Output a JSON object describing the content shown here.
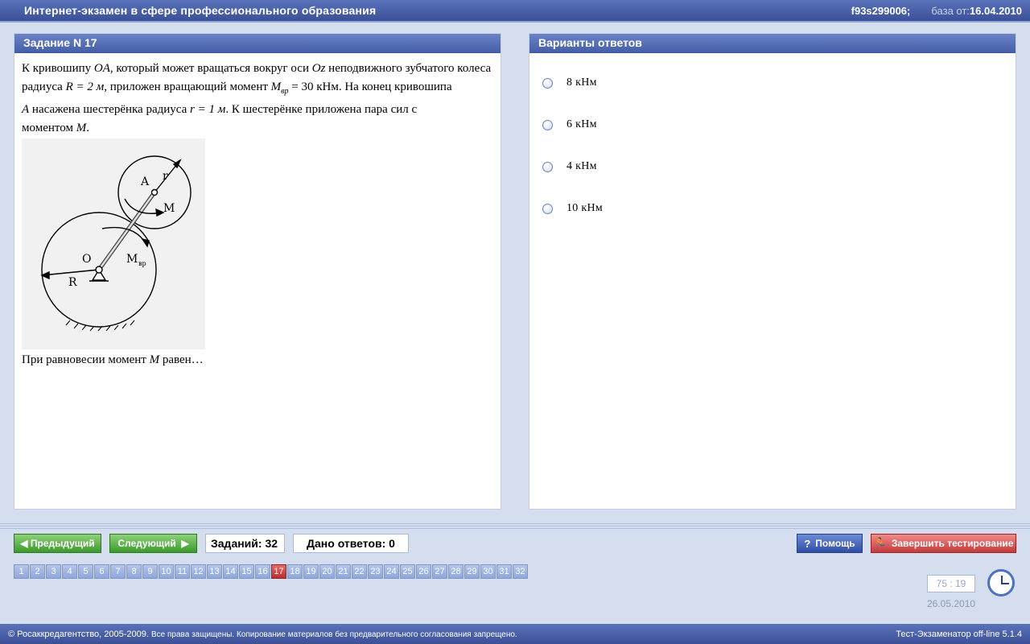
{
  "header": {
    "title": "Интернет-экзамен в сфере профессионального образования",
    "session_id": "f93s299006;",
    "base_label": "база от:",
    "base_date": "16.04.2010"
  },
  "task": {
    "title": "Задание N 17",
    "line1_a": "К кривошипу ",
    "sym_OA": "OA",
    "line1_b": ", который может вращаться вокруг оси ",
    "sym_Oz": "Oz",
    "line1_c": " неподвижного зубчатого колеса",
    "line2_a": "радиуса ",
    "expr_R": "R = 2 м",
    "line2_b": ", приложен вращающий момент ",
    "expr_M": "M",
    "expr_M_sub": "вр",
    "expr_M_val": " = 30 кНм",
    "line2_c": ". На конец кривошипа",
    "sym_A": "A",
    "line3_a": " насажена шестерёнка радиуса ",
    "expr_r": "r = 1 м",
    "line3_b": ". К шестерёнке приложена пара сил с",
    "line4_a": "моментом ",
    "sym_M": "M",
    "line4_b": ".",
    "question_a": "При равновесии момент ",
    "question_sym": "M",
    "question_b": " равен…",
    "figure_labels": {
      "A": "A",
      "r": "r",
      "M": "M",
      "O": "O",
      "Mvr": "M",
      "Mvr_sub": "вр",
      "R": "R"
    }
  },
  "answers": {
    "title": "Варианты ответов",
    "options": [
      "8 кНм",
      "6 кНм",
      "4 кНм",
      "10 кНм"
    ]
  },
  "nav": {
    "prev_label": "Предыдущий",
    "next_label": "Следующий",
    "tasks_count": "Заданий: 32",
    "answered_count": "Дано ответов: 0",
    "help_label": "Помощь",
    "finish_label": "Завершить тестирование",
    "current": "17",
    "numbers": [
      "1",
      "2",
      "3",
      "4",
      "5",
      "6",
      "7",
      "8",
      "9",
      "10",
      "11",
      "12",
      "13",
      "14",
      "15",
      "16",
      "17",
      "18",
      "19",
      "20",
      "21",
      "22",
      "23",
      "24",
      "25",
      "26",
      "27",
      "28",
      "29",
      "30",
      "31",
      "32"
    ],
    "timer": "75 : 19",
    "date": "26.05.2010"
  },
  "footer": {
    "copyright": "© Росаккредагентство, 2005-2009.",
    "rights": "Все права защищены. Копирование материалов без предварительного согласования запрещено.",
    "version": "Тест-Экзаменатор off-line 5.1.4"
  }
}
